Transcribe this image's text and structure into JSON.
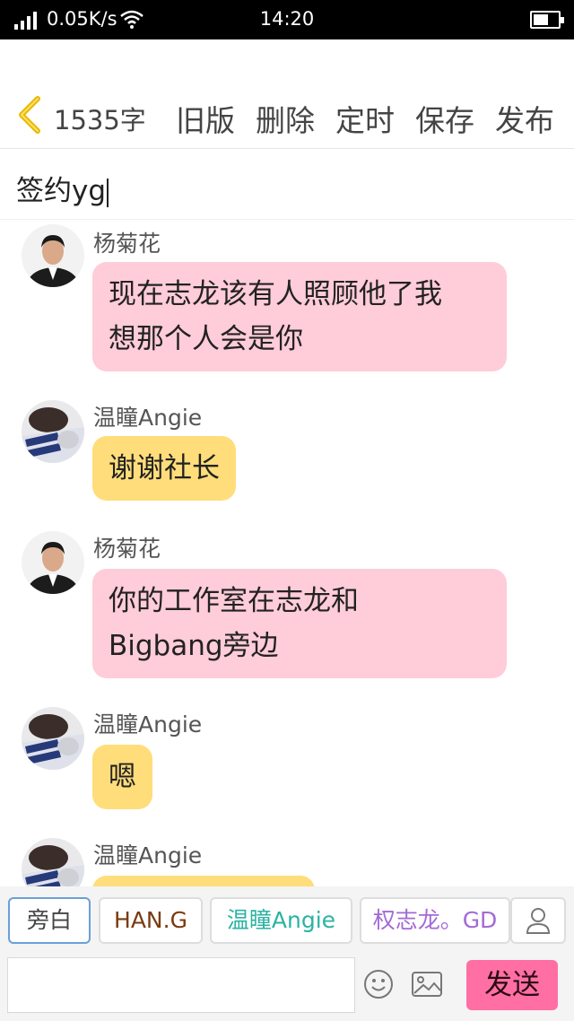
{
  "status_bar": {
    "net_speed": "0.05K/s",
    "time": "14:20",
    "battery_level": 0.6,
    "icons": [
      "signal-icon",
      "wifi-icon",
      "battery-icon"
    ]
  },
  "toolbar": {
    "back_icon": "chevron-left-icon",
    "word_count": "1535字",
    "old_version": "旧版",
    "delete": "删除",
    "schedule": "定时",
    "save": "保存",
    "publish": "发布"
  },
  "title": {
    "value": "签约yg"
  },
  "messages": [
    {
      "sender": "杨菊花",
      "text": "现在志龙该有人照顾他了我想那个人会是你",
      "lines": [
        "现在志龙该有人照顾他了我",
        "想那个人会是你"
      ],
      "color": "pink"
    },
    {
      "sender": "温瞳Angie",
      "text": "谢谢社长",
      "lines": [
        "谢谢社长"
      ],
      "color": "yellow"
    },
    {
      "sender": "杨菊花",
      "text": "你的工作室在志龙和Bigbang旁边",
      "lines": [
        "你的工作室在志龙和",
        "Bigbang旁边"
      ],
      "color": "pink"
    },
    {
      "sender": "温瞳Angie",
      "text": "嗯",
      "lines": [
        "嗯"
      ],
      "color": "yellow"
    },
    {
      "sender": "温瞳Angie",
      "text": "",
      "lines": [
        ""
      ],
      "color": "yellow"
    }
  ],
  "roles": {
    "narration": "旁白",
    "han_g": "HAN.G",
    "angie": "温瞳Angie",
    "gd": "权志龙。GD",
    "add_icon": "person-icon"
  },
  "composer": {
    "input_value": "",
    "send": "发送",
    "emoji_icon": "emoji-icon",
    "image_icon": "image-icon"
  },
  "colors": {
    "pink_bubble": "#ffccd9",
    "yellow_bubble": "#ffdd7a",
    "send_button": "#ff6fa3",
    "back_chevron": "#f2c400",
    "angie_role": "#2bb3a3",
    "gd_role": "#a36ad6"
  }
}
